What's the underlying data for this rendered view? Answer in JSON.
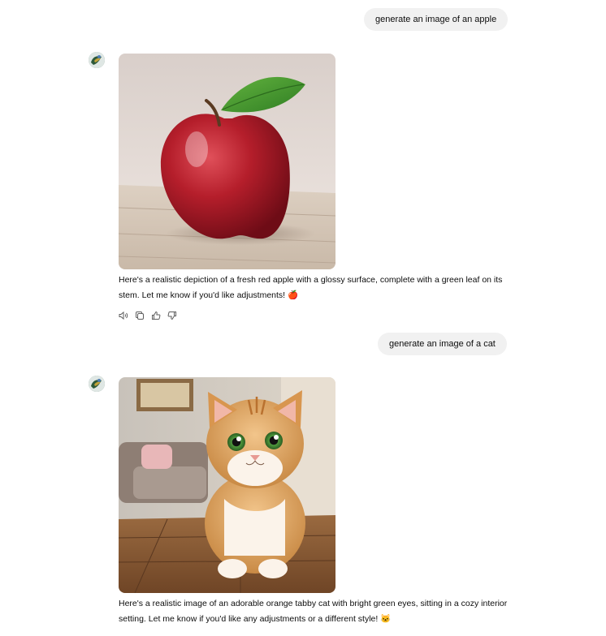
{
  "conversation": {
    "messages": [
      {
        "role": "user",
        "text": "generate an image of an apple"
      },
      {
        "role": "assistant",
        "image": "red-apple-with-leaf",
        "text": "Here's a realistic depiction of a fresh red apple with a glossy surface, complete with a green leaf on its stem. Let me know if you'd like adjustments! 🍎",
        "actions": [
          "read-aloud-icon",
          "copy-icon",
          "thumbs-up-icon",
          "thumbs-down-icon"
        ]
      },
      {
        "role": "user",
        "text": "generate an image of a cat"
      },
      {
        "role": "assistant",
        "image": "orange-tabby-cat-living-room",
        "text": "Here's a realistic image of an adorable orange tabby cat with bright green eyes, sitting in a cozy interior setting. Let me know if you'd like any adjustments or a different style! 🐱"
      }
    ]
  },
  "colors": {
    "page_background": "#ffffff",
    "user_bubble": "#f1f1f1",
    "text": "#0d0d0d",
    "icon": "#5d5d5d"
  }
}
